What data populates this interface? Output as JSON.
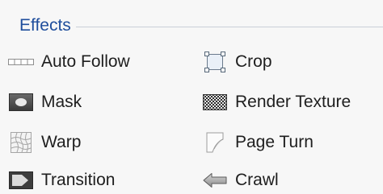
{
  "effects": {
    "title": "Effects",
    "items": [
      {
        "label": "Auto Follow",
        "icon": "auto-follow-icon"
      },
      {
        "label": "Mask",
        "icon": "mask-icon"
      },
      {
        "label": "Warp",
        "icon": "warp-icon"
      },
      {
        "label": "Transition",
        "icon": "transition-icon"
      },
      {
        "label": "Crop",
        "icon": "crop-icon"
      },
      {
        "label": "Render Texture",
        "icon": "render-texture-icon"
      },
      {
        "label": "Page Turn",
        "icon": "page-turn-icon"
      },
      {
        "label": "Crawl",
        "icon": "crawl-icon"
      }
    ]
  },
  "colors": {
    "title": "#1f4e9c",
    "text": "#1e1e1e",
    "background": "#f7f7f7"
  }
}
